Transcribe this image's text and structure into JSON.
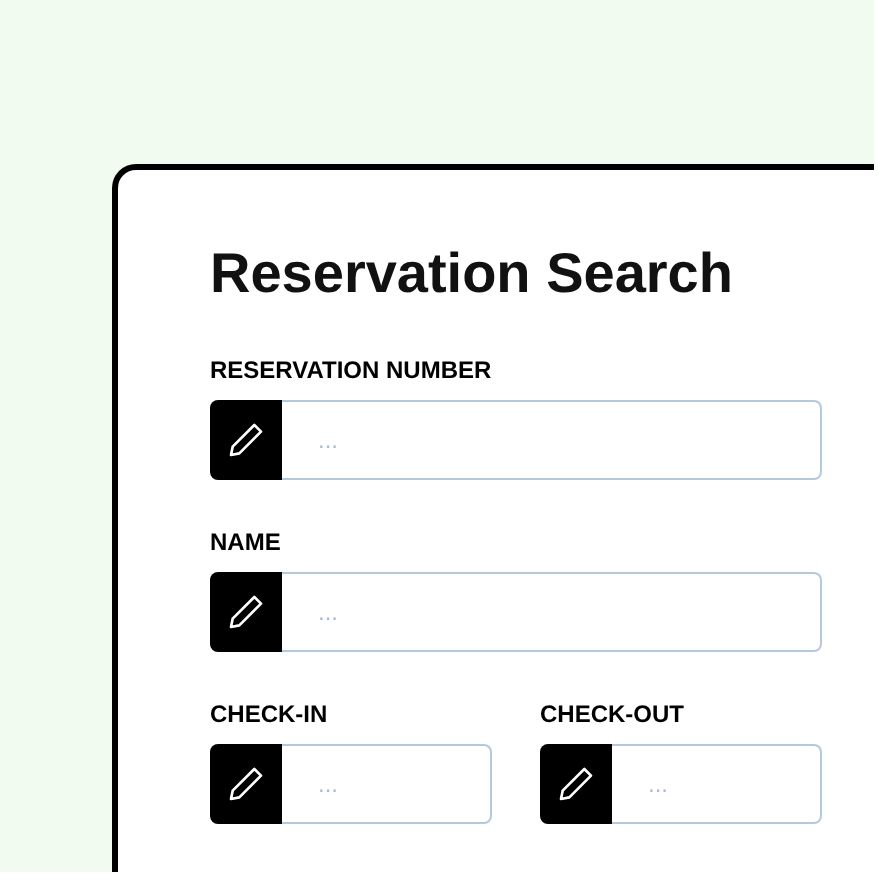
{
  "title": "Reservation Search",
  "rows": [
    [
      {
        "label": "RESERVATION NUMBER",
        "placeholder": "..."
      }
    ],
    [
      {
        "label": "NAME",
        "placeholder": "..."
      }
    ],
    [
      {
        "label": "CHECK-IN",
        "placeholder": "..."
      },
      {
        "label": "CHECK-OUT",
        "placeholder": "..."
      }
    ]
  ]
}
